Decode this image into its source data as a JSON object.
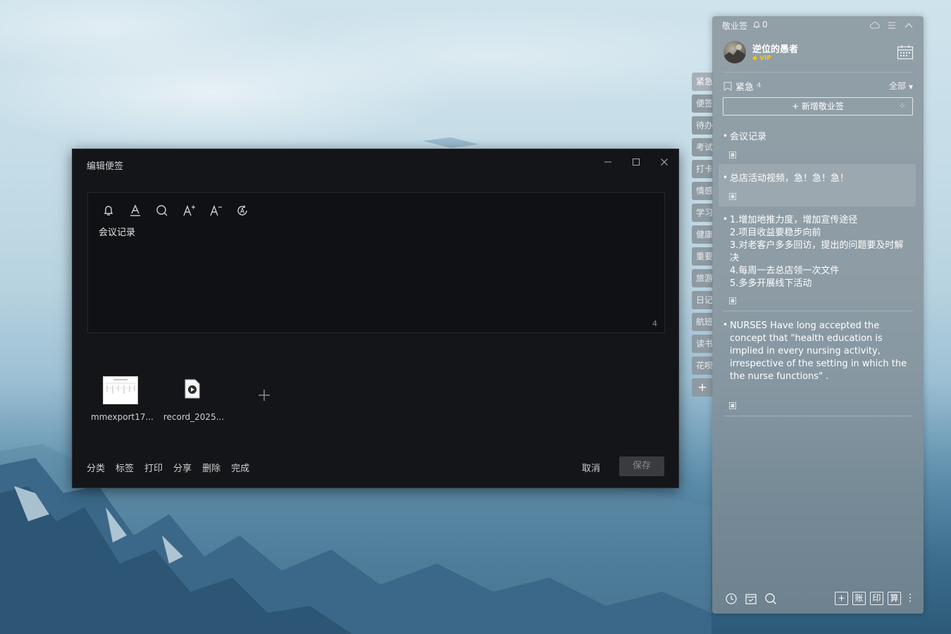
{
  "editor": {
    "title": "编辑便签",
    "note_text": "会议记录",
    "char_count": "4",
    "attachments": [
      {
        "name": "mmexport17...",
        "type": "image"
      },
      {
        "name": "record_2025...",
        "type": "audio"
      }
    ],
    "footer_actions": [
      "分类",
      "标签",
      "打印",
      "分享",
      "删除",
      "完成"
    ],
    "cancel_label": "取消",
    "save_label": "保存",
    "toolbar_icons": [
      "bell-icon",
      "font-color-icon",
      "search-icon",
      "font-increase-icon",
      "font-decrease-icon",
      "auto-format-icon"
    ]
  },
  "side_tabs": [
    "紧急",
    "便签",
    "待办",
    "考试",
    "打卡",
    "情感",
    "学习",
    "健康",
    "重要",
    "旅游",
    "日记",
    "航班",
    "读书",
    "花呗"
  ],
  "side_tab_add": "+",
  "panel": {
    "app_name": "敬业签",
    "bell_count": "0",
    "username": "逆位的愚者",
    "vip_label": "VIP",
    "category": {
      "name": "紧急",
      "count": "4",
      "filter": "全部"
    },
    "new_note_label": "+ 新增敬业签",
    "notes": [
      {
        "lines": [
          "会议记录"
        ]
      },
      {
        "lines": [
          "总店活动视频，急！急！急！"
        ]
      },
      {
        "lines": [
          "1.增加地推力度，增加宣传途径",
          "2.项目收益要稳步向前",
          "3.对老客户多多回访，提出的问题要及时解",
          "决",
          "4.每周一去总店领一次文件",
          "5.多多开展线下活动"
        ]
      },
      {
        "lines": [
          "NURSES Have long accepted the",
          "concept that \"health education is",
          "implied in every nursing activity,",
          "irrespective of the setting in which the",
          "the nurse functions\" ."
        ]
      }
    ],
    "bottom_buttons": [
      "+",
      "账",
      "印",
      "算"
    ],
    "more": "⋮"
  },
  "colors": {
    "editor_bg": "#141519",
    "panel_bg": "#808c94",
    "vip": "#f5c518"
  }
}
